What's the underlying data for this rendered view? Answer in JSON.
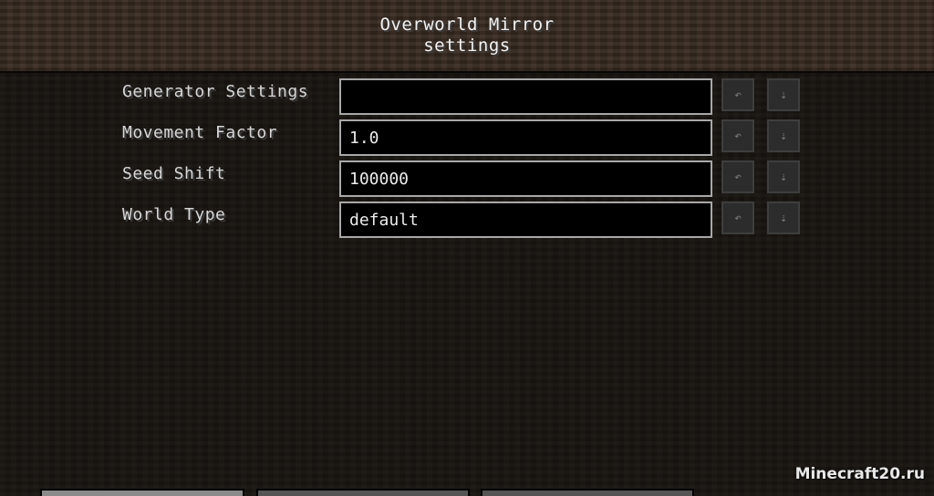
{
  "header": {
    "title_line1": "Overworld Mirror",
    "title_line2": "settings"
  },
  "settings": [
    {
      "label": "Generator Settings",
      "value": ""
    },
    {
      "label": "Movement Factor",
      "value": "1.0"
    },
    {
      "label": "Seed Shift",
      "value": "100000"
    },
    {
      "label": "World Type",
      "value": "default"
    }
  ],
  "icons": {
    "undo": "undo-arrow-icon",
    "reset": "reset-default-icon"
  },
  "watermark": "Minecraft20.ru"
}
